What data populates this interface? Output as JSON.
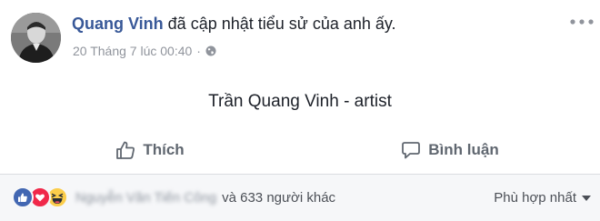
{
  "post": {
    "author_name": "Quang Vinh",
    "action_text": "đã cập nhật tiểu sử của anh ấy.",
    "timestamp": "20 Tháng 7 lúc 00:40",
    "meta_separator": "·",
    "privacy_icon": "globe-icon",
    "body_text": "Trần Quang Vinh - artist"
  },
  "actions": {
    "like_label": "Thích",
    "comment_label": "Bình luận"
  },
  "reactions": {
    "icons": [
      "like-icon",
      "love-icon",
      "haha-icon"
    ],
    "blurred_names": "Nguyễn Văn Tiến Công",
    "others_text": "và 633 người khác"
  },
  "sort": {
    "label": "Phù hợp nhất"
  },
  "colors": {
    "name_blue": "#385898",
    "like_blue": "#4267b2",
    "love_red": "#f0284a",
    "haha_yellow": "#fbcd4b",
    "muted_gray": "#90949c",
    "footer_bg": "#f6f7f9"
  }
}
